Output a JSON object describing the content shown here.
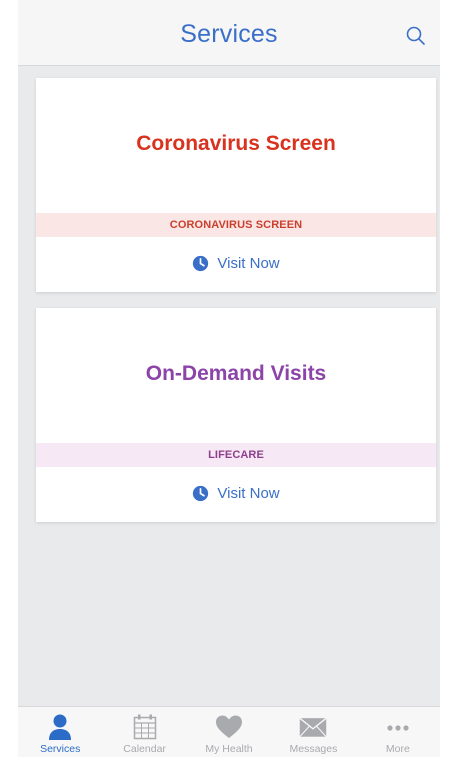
{
  "header": {
    "title": "Services",
    "search_icon": "search-icon"
  },
  "cards": [
    {
      "title": "Coronavirus Screen",
      "band_label": "CORONAVIRUS SCREEN",
      "action_label": "Visit Now",
      "title_color": "#d9321f"
    },
    {
      "title": "On-Demand Visits",
      "band_label": "LIFECARE",
      "action_label": "Visit Now",
      "title_color": "#8c44a8"
    }
  ],
  "tabbar": {
    "items": [
      {
        "label": "Services",
        "icon": "person-icon",
        "active": true
      },
      {
        "label": "Calendar",
        "icon": "calendar-icon",
        "active": false
      },
      {
        "label": "My Health",
        "icon": "heart-icon",
        "active": false
      },
      {
        "label": "Messages",
        "icon": "envelope-icon",
        "active": false
      },
      {
        "label": "More",
        "icon": "more-dots-icon",
        "active": false
      }
    ]
  },
  "colors": {
    "accent": "#3a6fc8",
    "active_tab": "#2c6cc6",
    "inactive_tab": "#a9aaad",
    "background": "#e9eaeb"
  }
}
